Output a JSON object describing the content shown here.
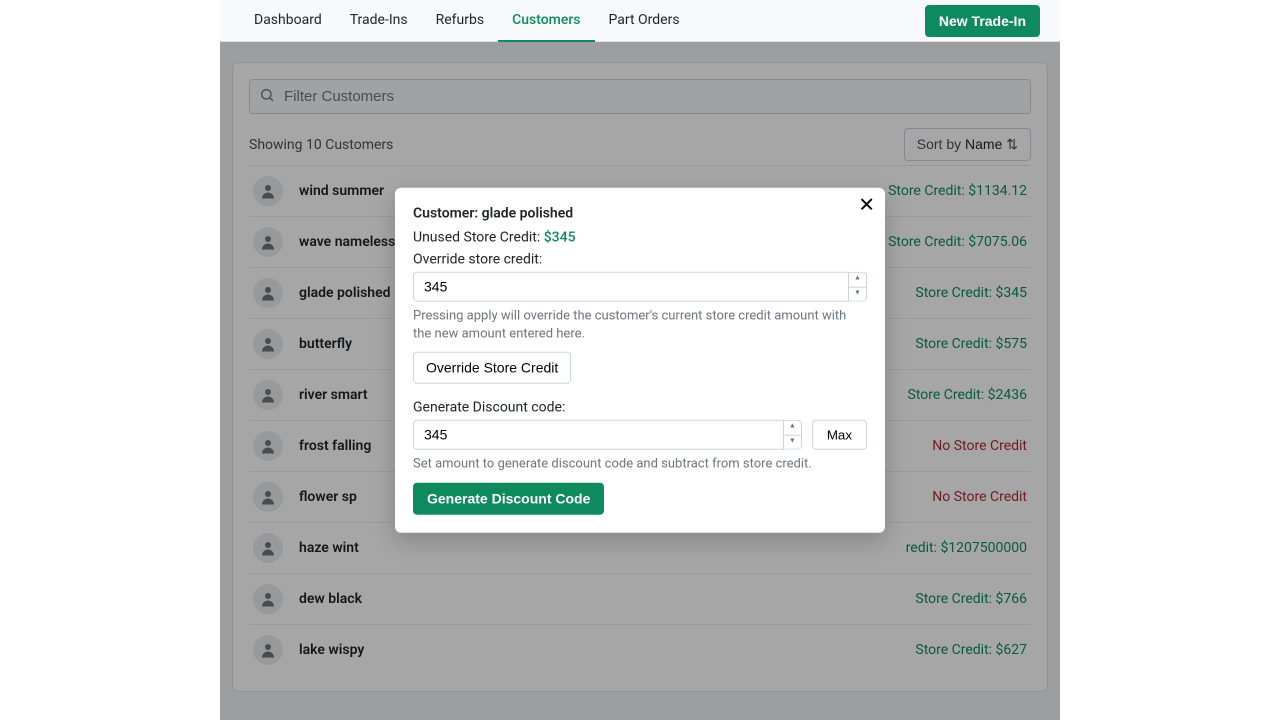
{
  "nav": {
    "items": [
      {
        "label": "Dashboard",
        "active": false
      },
      {
        "label": "Trade-Ins",
        "active": false
      },
      {
        "label": "Refurbs",
        "active": false
      },
      {
        "label": "Customers",
        "active": true
      },
      {
        "label": "Part Orders",
        "active": false
      }
    ],
    "cta": "New Trade-In"
  },
  "search": {
    "placeholder": "Filter Customers"
  },
  "list_header": {
    "showing": "Showing 10 Customers",
    "sort_prefix": "Sort by ",
    "sort_value": "Name"
  },
  "customers": [
    {
      "name": "wind summer",
      "credit_text": "Store Credit: $1134.12",
      "none": false
    },
    {
      "name": "wave nameless",
      "credit_text": "Store Credit: $7075.06",
      "none": false
    },
    {
      "name": "glade polished",
      "credit_text": "Store Credit: $345",
      "none": false
    },
    {
      "name": "butterfly",
      "credit_text": "Store Credit: $575",
      "none": false
    },
    {
      "name": "river smart",
      "credit_text": "Store Credit: $2436",
      "none": false
    },
    {
      "name": "frost falling",
      "credit_text": "No Store Credit",
      "none": true
    },
    {
      "name": "flower sp",
      "credit_text": "No Store Credit",
      "none": true
    },
    {
      "name": "haze wint",
      "credit_text": "redit: $1207500000",
      "none": false
    },
    {
      "name": "dew black",
      "credit_text": "Store Credit: $766",
      "none": false
    },
    {
      "name": "lake wispy",
      "credit_text": "Store Credit: $627",
      "none": false
    }
  ],
  "modal": {
    "title": "Customer: glade polished",
    "unused_label": "Unused Store Credit: ",
    "unused_value": "$345",
    "override_label": "Override store credit:",
    "override_value": "345",
    "override_help": "Pressing apply will override the customer's current store credit amount with the new amount entered here.",
    "override_btn": "Override Store Credit",
    "gen_label": "Generate Discount code:",
    "gen_value": "345",
    "max_btn": "Max",
    "gen_help": "Set amount to generate discount code and subtract from store credit.",
    "gen_btn": "Generate Discount Code"
  }
}
